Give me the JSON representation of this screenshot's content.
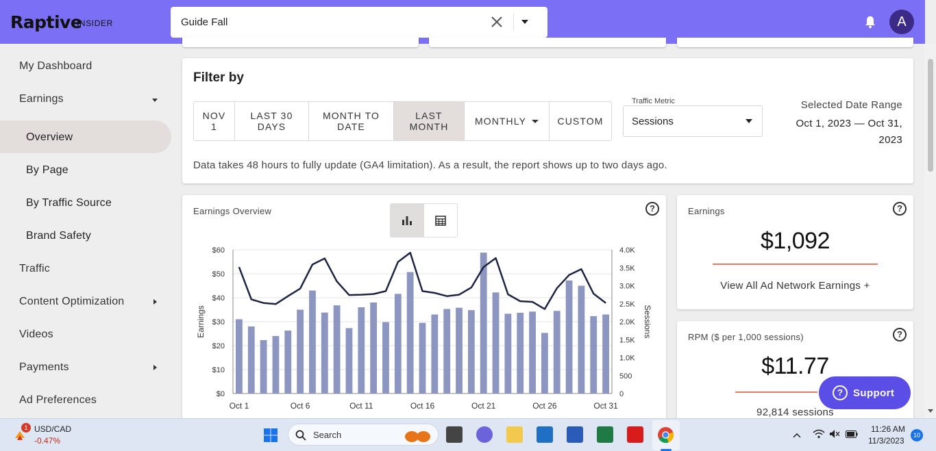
{
  "header": {
    "brand": "Raptive",
    "brand_sub": "INSIDER",
    "search_value": "Guide Fall",
    "avatar_initial": "A"
  },
  "sidebar": {
    "items": [
      {
        "label": "My Dashboard"
      },
      {
        "label": "Earnings"
      },
      {
        "label": "Overview"
      },
      {
        "label": "By Page"
      },
      {
        "label": "By Traffic Source"
      },
      {
        "label": "Brand Safety"
      },
      {
        "label": "Traffic"
      },
      {
        "label": "Content Optimization"
      },
      {
        "label": "Videos"
      },
      {
        "label": "Payments"
      },
      {
        "label": "Ad Preferences"
      }
    ]
  },
  "filter": {
    "title": "Filter by",
    "buttons": [
      {
        "label": "NOV\n1"
      },
      {
        "label": "LAST 30\nDAYS"
      },
      {
        "label": "MONTH TO\nDATE"
      },
      {
        "label": "LAST\nMONTH"
      },
      {
        "label": "MONTHLY"
      },
      {
        "label": "CUSTOM"
      }
    ],
    "metric_label": "Traffic Metric",
    "metric_value": "Sessions",
    "range_title": "Selected Date Range",
    "range_value": "Oct 1, 2023 — Oct 31, 2023",
    "note": "Data takes 48 hours to fully update (GA4 limitation). As a result, the report shows up to two days ago."
  },
  "overview": {
    "title": "Earnings Overview",
    "help": "?"
  },
  "earnings_card": {
    "title": "Earnings",
    "value": "$1,092",
    "link": "View All Ad Network Earnings +",
    "help": "?",
    "accent": "#ea7b62"
  },
  "rpm_card": {
    "title": "RPM ($ per 1,000 sessions)",
    "value": "$11.77",
    "sessions": "92,814 sessions",
    "help": "?"
  },
  "support": {
    "label": "Support",
    "icon": "?"
  },
  "colors": {
    "brand": "#7a6ff5",
    "bar": "#8c96c0",
    "line": "#1d2440",
    "support": "#5b4ee6"
  },
  "chart_data": {
    "type": "bar",
    "x_labels": [
      "Oct 1",
      "Oct 2",
      "Oct 3",
      "Oct 4",
      "Oct 5",
      "Oct 6",
      "Oct 7",
      "Oct 8",
      "Oct 9",
      "Oct 10",
      "Oct 11",
      "Oct 12",
      "Oct 13",
      "Oct 14",
      "Oct 15",
      "Oct 16",
      "Oct 17",
      "Oct 18",
      "Oct 19",
      "Oct 20",
      "Oct 21",
      "Oct 22",
      "Oct 23",
      "Oct 24",
      "Oct 25",
      "Oct 26",
      "Oct 27",
      "Oct 28",
      "Oct 29",
      "Oct 30",
      "Oct 31"
    ],
    "x_tick_labels": [
      "Oct 1",
      "Oct 6",
      "Oct 11",
      "Oct 16",
      "Oct 21",
      "Oct 26",
      "Oct 31"
    ],
    "series": [
      {
        "name": "Earnings",
        "axis": "left",
        "kind": "bar",
        "values": [
          31,
          28,
          22.3,
          24,
          26.3,
          35,
          43,
          33.8,
          36.8,
          27.3,
          36,
          38,
          29.8,
          41.6,
          50.7,
          29.5,
          33,
          35.3,
          35.8,
          34.8,
          58.8,
          42.2,
          33.3,
          33.7,
          34.2,
          25.3,
          34.5,
          47.2,
          45,
          32.3,
          33
        ]
      },
      {
        "name": "Sessions",
        "axis": "right",
        "kind": "line",
        "values": [
          3520,
          2620,
          2520,
          2490,
          2710,
          2920,
          3590,
          3760,
          3120,
          2740,
          2750,
          2770,
          2850,
          3660,
          3920,
          2850,
          2800,
          2710,
          2750,
          2950,
          3520,
          3770,
          2760,
          2570,
          2550,
          2350,
          2930,
          3300,
          3460,
          2780,
          2520
        ]
      }
    ],
    "left_axis": {
      "label": "Earnings",
      "ticks": [
        "$0",
        "$10",
        "$20",
        "$30",
        "$40",
        "$50",
        "$60"
      ],
      "ylim": [
        0,
        60
      ]
    },
    "right_axis": {
      "label": "Sessions",
      "ticks": [
        "0",
        "500",
        "1.0K",
        "1.5K",
        "2.0K",
        "2.5K",
        "3.0K",
        "3.5K",
        "4.0K"
      ],
      "ylim": [
        0,
        4000
      ]
    },
    "grid": true
  },
  "taskbar": {
    "ticker_name": "USD/CAD",
    "ticker_change": "-0.47%",
    "ticker_badge": "1",
    "search_label": "Search",
    "time": "11:26 AM",
    "date": "11/3/2023",
    "notif_count": "10"
  }
}
